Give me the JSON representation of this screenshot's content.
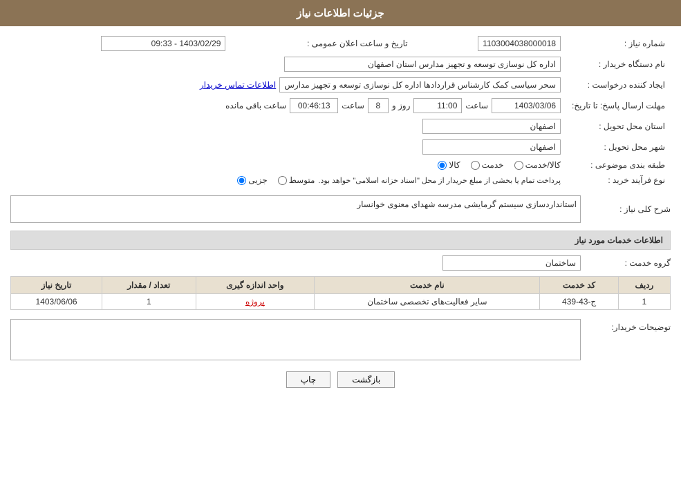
{
  "header": {
    "title": "جزئیات اطلاعات نیاز"
  },
  "fields": {
    "request_number_label": "شماره نیاز :",
    "request_number_value": "1103004038000018",
    "buyer_label": "نام دستگاه خریدار :",
    "buyer_value": "اداره کل نوسازی  توسعه و تجهیز مدارس استان اصفهان",
    "creator_label": "ایجاد کننده درخواست :",
    "creator_value": "سحر سیاسی کمک کارشناس قراردادها اداره کل نوسازی  توسعه و تجهیز مدارس",
    "contact_link": "اطلاعات تماس خریدار",
    "deadline_label": "مهلت ارسال پاسخ: تا تاریخ:",
    "public_announcement_label": "تاریخ و ساعت اعلان عمومی :",
    "public_announcement_value": "1403/02/29 - 09:33",
    "date_value": "1403/03/06",
    "time_value": "11:00",
    "days_value": "8",
    "remaining_time_value": "00:46:13",
    "days_label": "روز و",
    "hour_label": "ساعت",
    "remaining_label": "ساعت باقی مانده",
    "province_label": "استان محل تحویل :",
    "province_value": "اصفهان",
    "city_label": "شهر محل تحویل :",
    "city_value": "اصفهان",
    "category_label": "طبقه بندی موضوعی :",
    "category_options": [
      "کالا",
      "خدمت",
      "کالا/خدمت"
    ],
    "category_selected": "کالا",
    "purchase_type_label": "نوع فرآیند خرید :",
    "purchase_type_options": [
      "جزیی",
      "متوسط"
    ],
    "purchase_type_note": "پرداخت تمام یا بخشی از مبلغ خریدار از محل \"اسناد خزانه اسلامی\" خواهد بود.",
    "description_label": "شرح کلی نیاز :",
    "description_value": "استانداردسازی سیستم گرمایشی مدرسه شهدای معنوی خوانسار"
  },
  "service_section": {
    "title": "اطلاعات خدمات مورد نیاز",
    "group_label": "گروه خدمت :",
    "group_value": "ساختمان",
    "table": {
      "headers": [
        "ردیف",
        "کد خدمت",
        "نام خدمت",
        "واحد اندازه گیری",
        "تعداد / مقدار",
        "تاریخ نیاز"
      ],
      "rows": [
        {
          "row": "1",
          "code": "ج-43-439",
          "name": "سایر فعالیت‌های تخصصی ساختمان",
          "unit": "پروژه",
          "quantity": "1",
          "date": "1403/06/06"
        }
      ]
    }
  },
  "buyer_desc_label": "توضیحات خریدار:",
  "buttons": {
    "print": "چاپ",
    "back": "بازگشت"
  }
}
